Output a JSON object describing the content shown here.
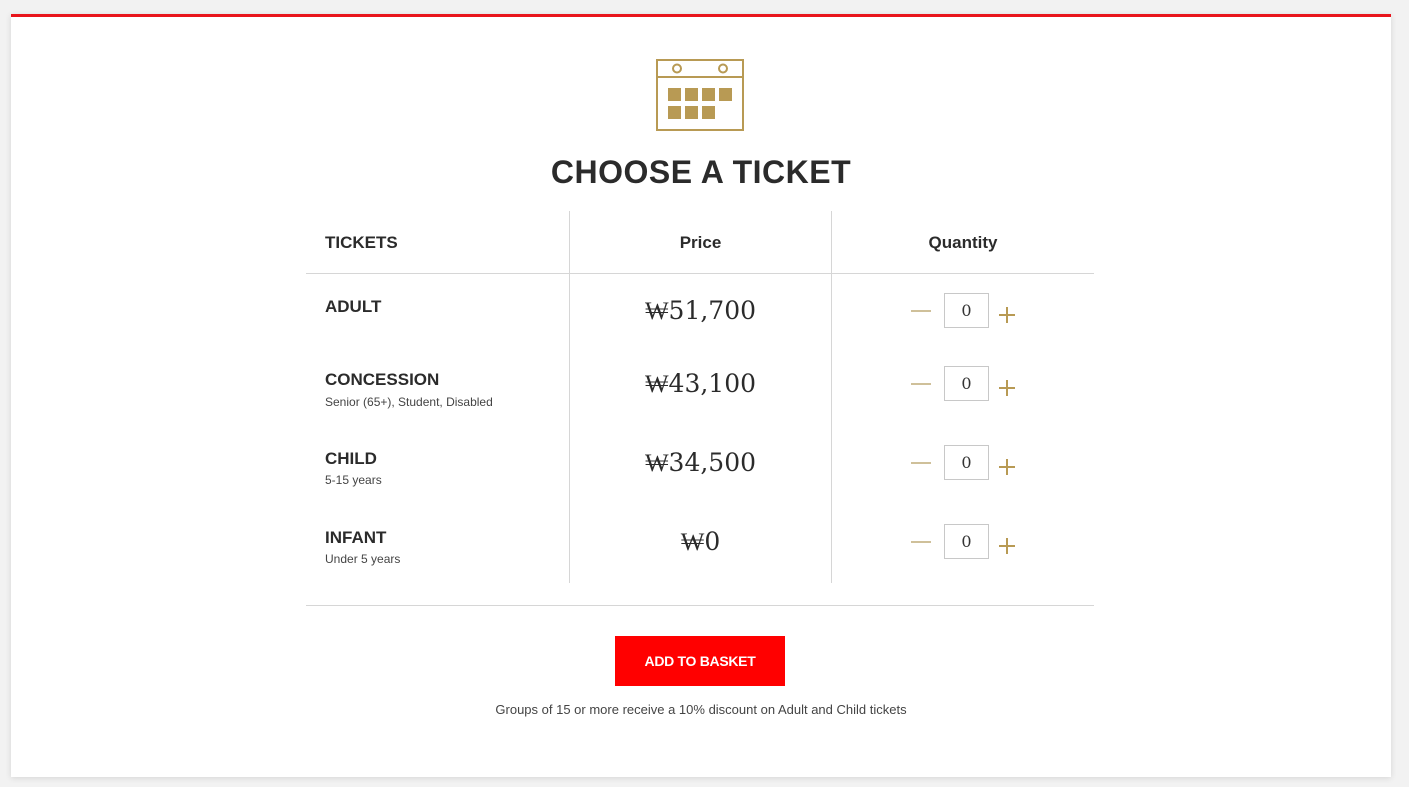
{
  "header": {
    "calendar_icon": "calendar-icon",
    "title": "CHOOSE A TICKET"
  },
  "colors": {
    "accent_red": "#e8141b",
    "button_red": "#ff0000",
    "gold": "#b89a54"
  },
  "table": {
    "columns": [
      "TICKETS",
      "Price",
      "Quantity"
    ],
    "rows": [
      {
        "name": "ADULT",
        "subtitle": "",
        "price": "₩51,700",
        "quantity": "0"
      },
      {
        "name": "CONCESSION",
        "subtitle": "Senior (65+), Student, Disabled",
        "price": "₩43,100",
        "quantity": "0"
      },
      {
        "name": "CHILD",
        "subtitle": "5-15 years",
        "price": "₩34,500",
        "quantity": "0"
      },
      {
        "name": "INFANT",
        "subtitle": "Under 5 years",
        "price": "₩0",
        "quantity": "0"
      }
    ]
  },
  "actions": {
    "add_to_basket": "ADD TO BASKET"
  },
  "footer": {
    "note": "Groups of 15 or more receive a 10% discount on Adult and Child tickets"
  }
}
